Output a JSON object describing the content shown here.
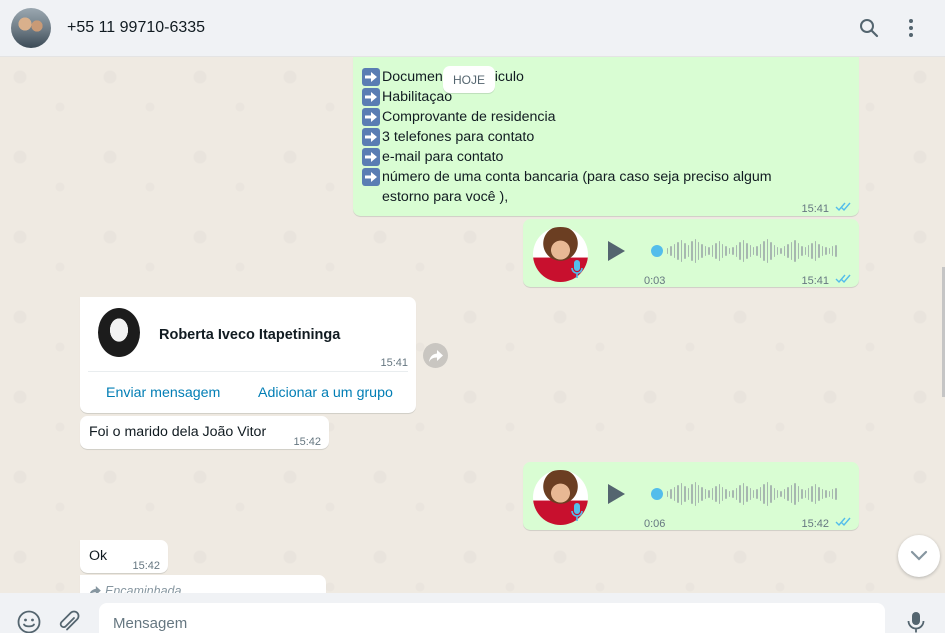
{
  "header": {
    "contact_name": "+55 11 99710-6335",
    "icons": [
      "search-icon",
      "menu-icon"
    ]
  },
  "chat": {
    "date_chip": "HOJE",
    "list_message": {
      "lines": [
        "Documen",
        "Habilitaçao",
        "Comprovante de residencia",
        "3 telefones para contato",
        "e-mail para contato",
        "número de uma conta bancaria (para caso seja preciso algum estorno para você ),"
      ],
      "hidden_suffix": "iculo",
      "time": "15:41"
    },
    "voice_1": {
      "duration": "0:03",
      "time": "15:41"
    },
    "contact_card": {
      "name": "Roberta Iveco Itapetininga",
      "time": "15:41",
      "action_message": "Enviar mensagem",
      "action_group": "Adicionar a um grupo"
    },
    "msg_foi": {
      "text": "Foi o marido dela João Vitor",
      "time": "15:42"
    },
    "voice_2": {
      "duration": "0:06",
      "time": "15:42"
    },
    "msg_ok": {
      "text": "Ok",
      "time": "15:42"
    },
    "forwarded": {
      "label": "Encaminhada"
    }
  },
  "composer": {
    "placeholder": "Mensagem"
  },
  "colors": {
    "outgoing_bubble": "#d9fdd3",
    "incoming_bubble": "#ffffff",
    "read_ticks": "#53bdeb",
    "link": "#027eb5",
    "background": "#efeae2"
  }
}
